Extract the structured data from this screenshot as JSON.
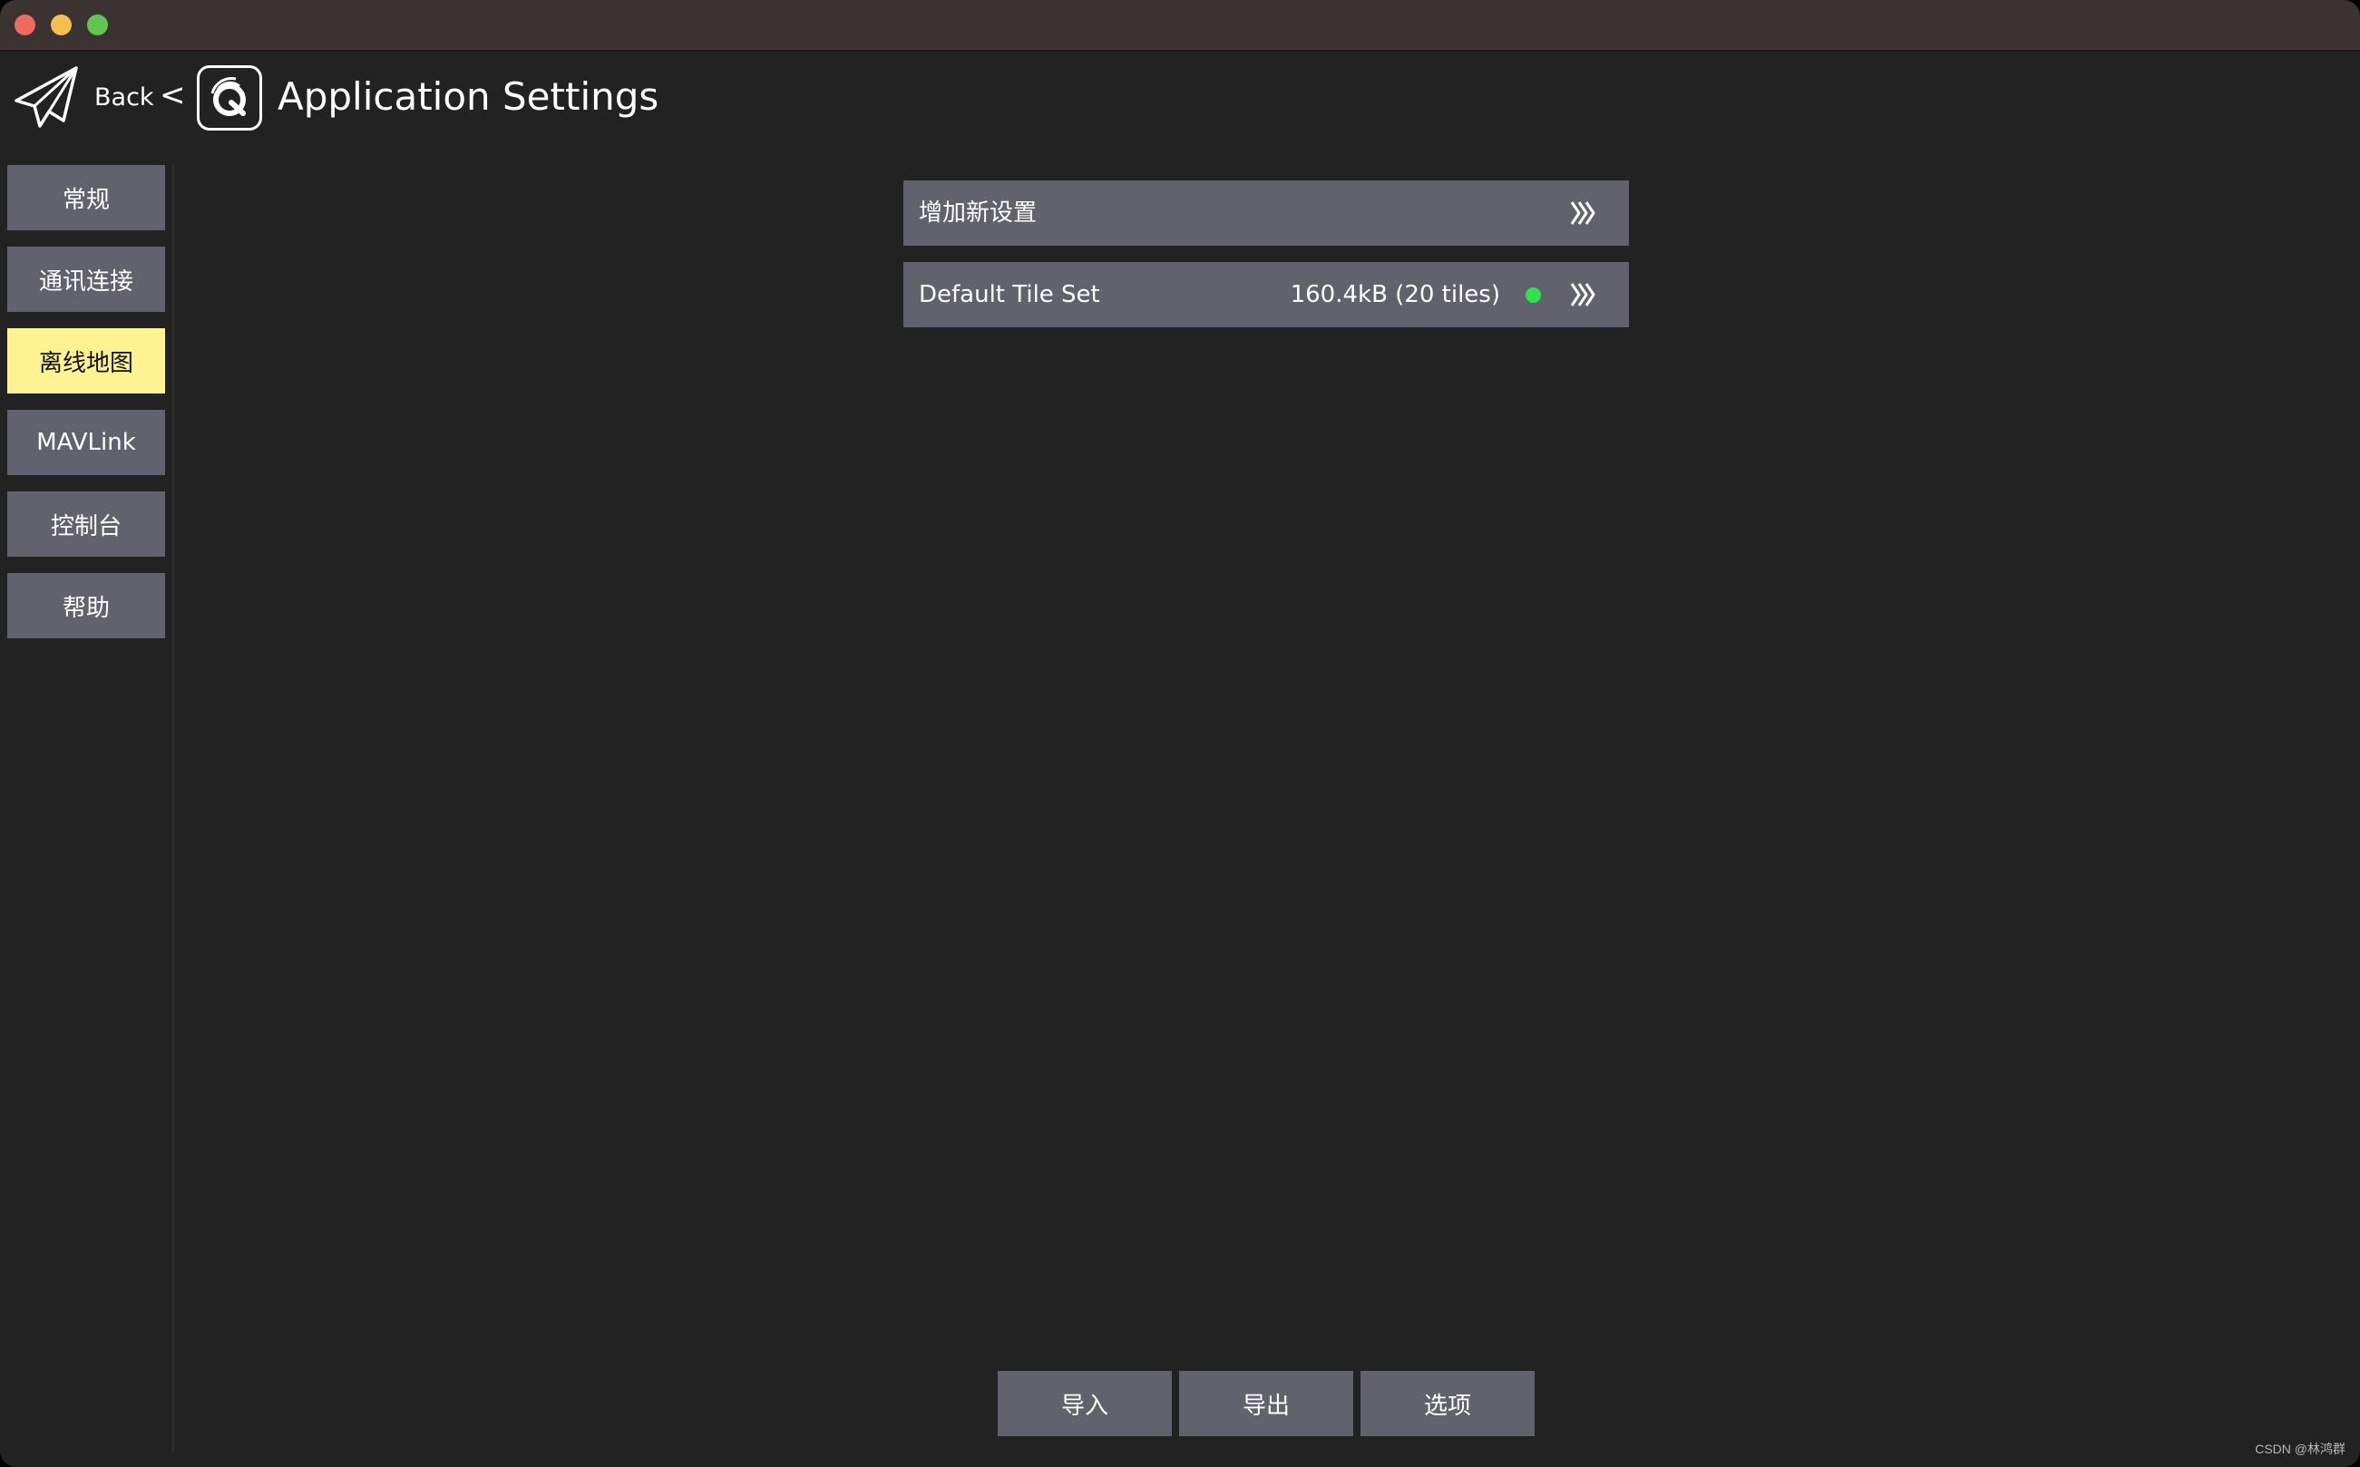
{
  "window": {
    "controls": [
      "close",
      "minimize",
      "maximize"
    ]
  },
  "toolbar": {
    "back_label": "Back",
    "separator": "<",
    "title": "Application Settings",
    "icons": [
      "paper-plane-icon",
      "chevron-left-icon",
      "qgc-logo-icon"
    ]
  },
  "sidebar": {
    "items": [
      {
        "label": "常规",
        "active": false
      },
      {
        "label": "通讯连接",
        "active": false
      },
      {
        "label": "离线地图",
        "active": true
      },
      {
        "label": "MAVLink",
        "active": false
      },
      {
        "label": "控制台",
        "active": false
      },
      {
        "label": "帮助",
        "active": false
      }
    ]
  },
  "tile_sets": [
    {
      "label": "增加新设置",
      "size": "",
      "status": "",
      "icon": "triple-chevron-right-icon"
    },
    {
      "label": "Default Tile Set",
      "size": "160.4kB (20 tiles)",
      "status": "complete",
      "icon": "triple-chevron-right-icon"
    }
  ],
  "bottom_buttons": {
    "import_label": "导入",
    "export_label": "导出",
    "options_label": "选项"
  },
  "watermark": "CSDN @林鸿群",
  "colors": {
    "background": "#222222",
    "titlebar": "#3b3331",
    "button": "#62616e",
    "active_button": "#fff291",
    "status_ok": "#2ee34a"
  }
}
